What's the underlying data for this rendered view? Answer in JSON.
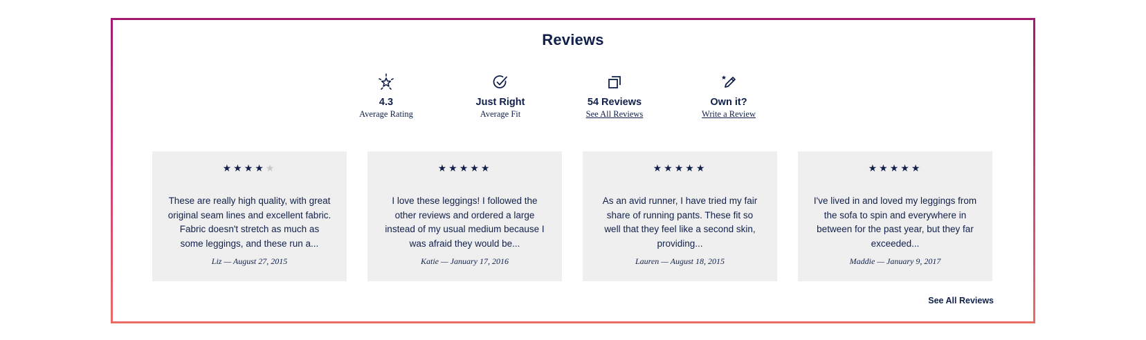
{
  "reviews_section": {
    "title": "Reviews",
    "accent_gradient": [
      "#a0196f",
      "#ea6a64"
    ],
    "text_color": "#10204a",
    "card_background": "#efefef",
    "stats": [
      {
        "icon": "star-burst-icon",
        "value": "4.3",
        "label": "Average Rating"
      },
      {
        "icon": "check-circle-icon",
        "value": "Just Right",
        "label": "Average Fit"
      },
      {
        "icon": "stacked-squares-icon",
        "value": "54 Reviews",
        "label": "See All Reviews"
      },
      {
        "icon": "pencil-star-icon",
        "value": "Own it?",
        "label": "Write a Review"
      }
    ],
    "reviews": [
      {
        "rating": 4,
        "text": "These are really high quality, with great original seam lines and excellent fabric. Fabric doesn't stretch as much as some leggings, and these run a...",
        "meta": "Liz — August 27, 2015"
      },
      {
        "rating": 5,
        "text": "I love these leggings! I followed the other reviews and ordered a large instead of my usual medium because I was afraid they would be...",
        "meta": "Katie — January 17, 2016"
      },
      {
        "rating": 5,
        "text": "As an avid runner, I have tried my fair share of running pants. These fit so well that they feel like a second skin, providing...",
        "meta": "Lauren — August 18, 2015"
      },
      {
        "rating": 5,
        "text": "I've lived in and loved my leggings from the sofa to spin and everywhere in between for the past year, but they far exceeded...",
        "meta": "Maddie — January 9, 2017"
      }
    ],
    "see_all_label": "See All Reviews"
  }
}
